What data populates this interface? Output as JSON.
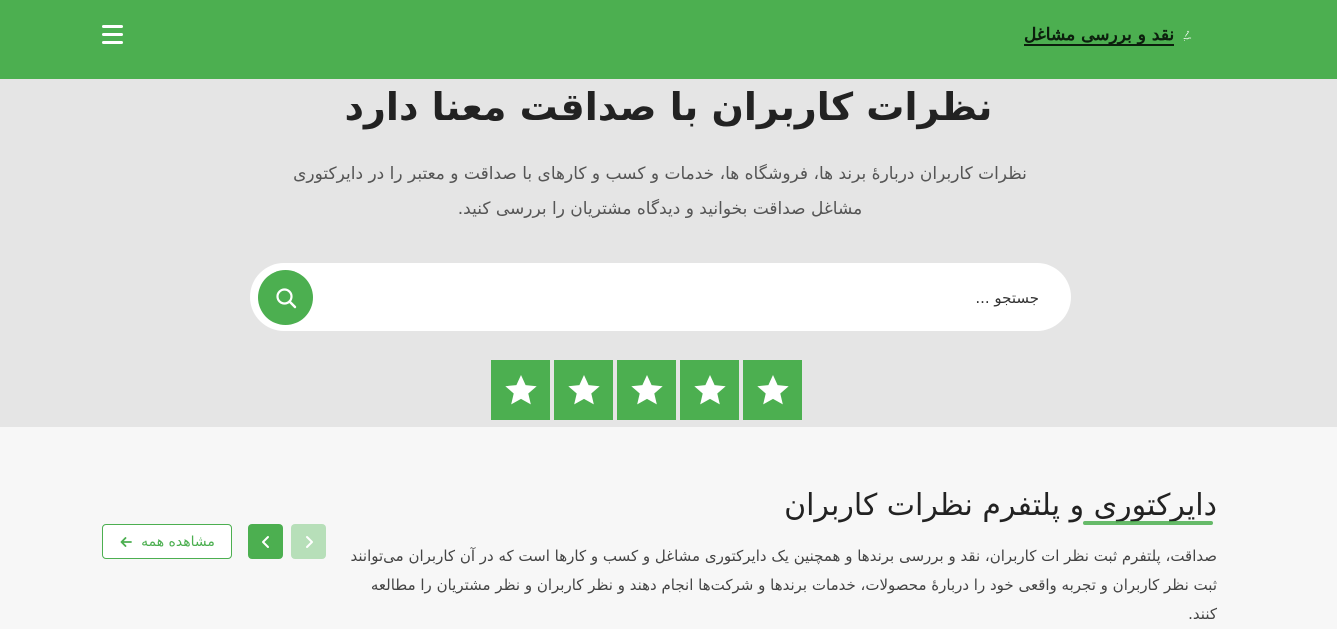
{
  "header": {
    "logo_text": "نقد و بررسی مشاغل",
    "logo_mark": "صداقت",
    "menu_icon": "hamburger-menu-icon",
    "brand_color": "#4caf50"
  },
  "hero": {
    "title": "نظرات کاربران با صداقت معنا دارد",
    "description": "نظرات کاربران دربارۀ برند ها، فروشگاه ها، خدمات و کسب و کارهای با صداقت و معتبر را در دایرکتوری مشاغل صداقت بخوانید و دیدگاه مشتریان را بررسی کنید.",
    "search_placeholder": "جستجو ...",
    "search_icon": "search-icon",
    "rating_stars": 5
  },
  "section": {
    "title": "دایرکتوری و پلتفرم نظرات کاربران",
    "text": "صداقت، پلتفرم ثبت نظر ات کاربران، نقد و بررسی برندها و همچنین یک دایرکتوری مشاغل و کسب و کارها است که در آن کاربران می‌توانند ثبت نظر کاربران و تجربه واقعی خود را دربارۀ محصولات، خدمات برندها و شرکت‌ها انجام دهند و نظر کاربران و نظر مشتریان را مطالعه کنند.",
    "view_all_label": "مشاهده همه",
    "view_all_icon": "arrow-left-icon",
    "next_icon": "chevron-left-icon",
    "prev_icon": "chevron-right-icon"
  }
}
